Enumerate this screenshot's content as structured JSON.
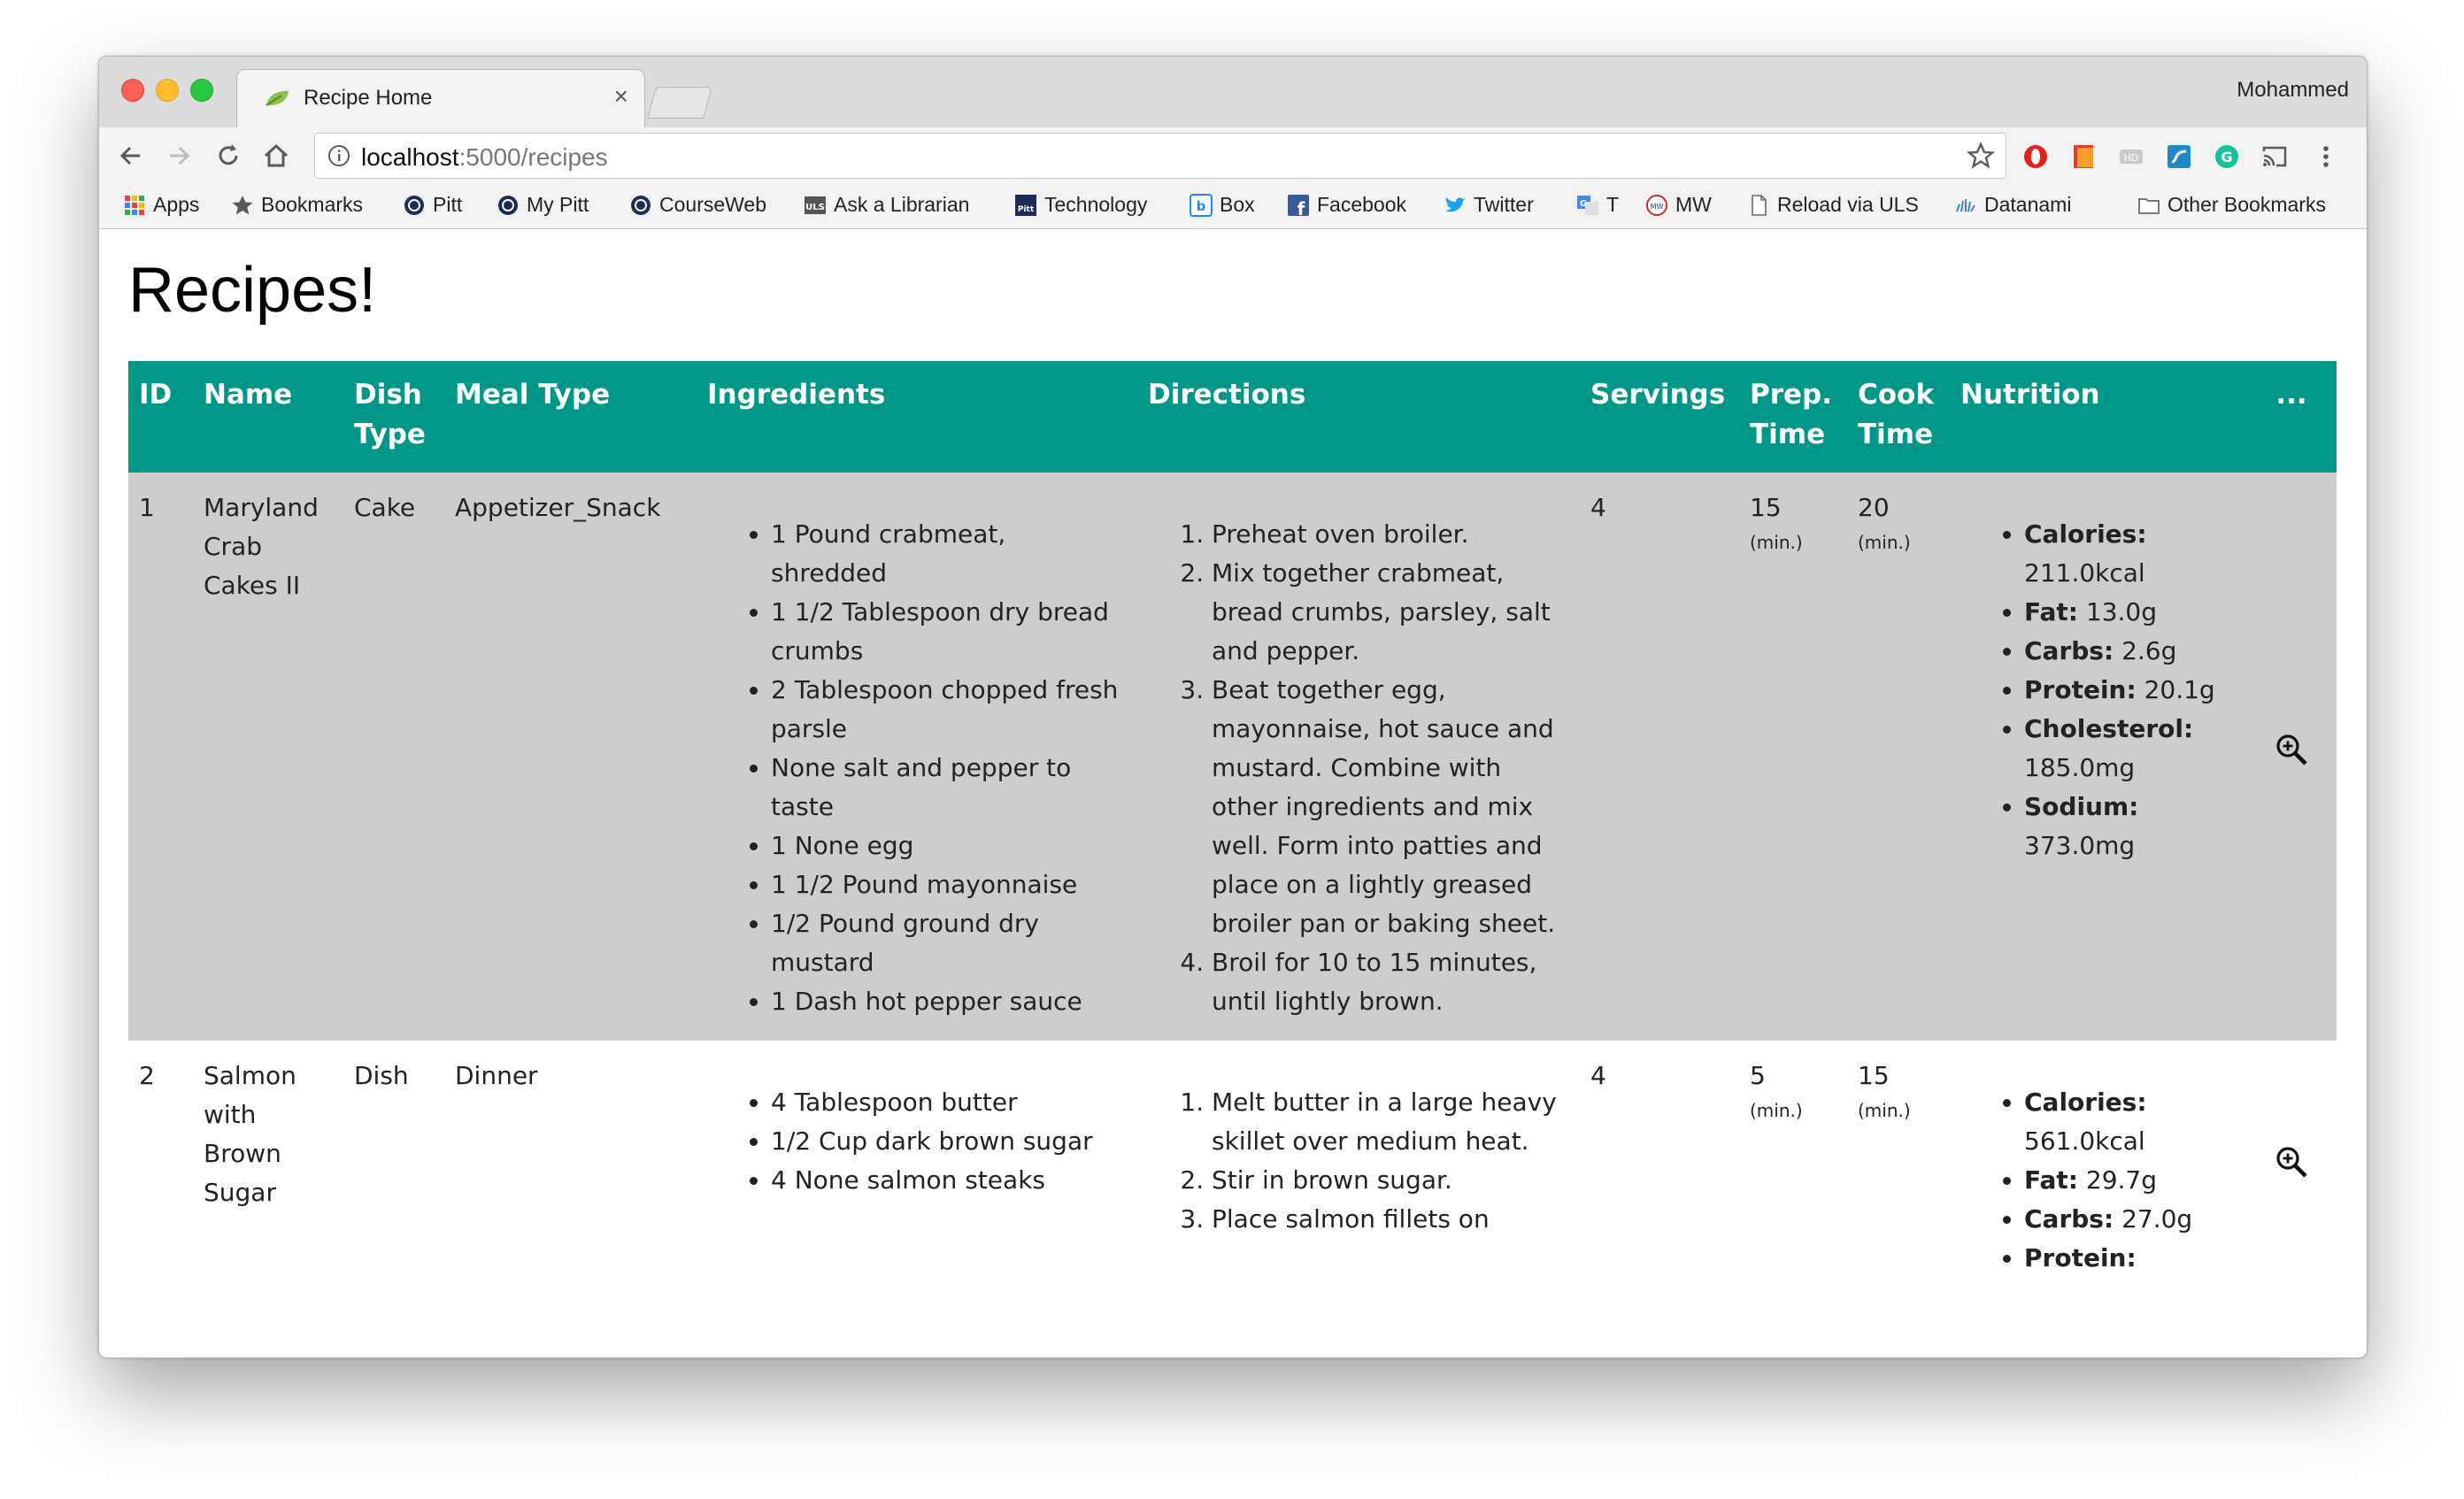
{
  "browser": {
    "tab_title": "Recipe Home",
    "tab_close": "×",
    "profile_name": "Mohammed",
    "url_host": "localhost",
    "url_path": ":5000/recipes"
  },
  "bookmarks": [
    {
      "label": "Apps",
      "icon": "apps-grid-icon"
    },
    {
      "label": "Bookmarks",
      "icon": "star-icon"
    },
    {
      "label": "Pitt",
      "icon": "pitt-seal-icon"
    },
    {
      "label": "My Pitt",
      "icon": "pitt-seal-icon"
    },
    {
      "label": "CourseWeb",
      "icon": "pitt-seal-icon"
    },
    {
      "label": "Ask a Librarian",
      "icon": "uls-icon"
    },
    {
      "label": "Technology",
      "icon": "pitt-tech-icon"
    },
    {
      "label": "Box",
      "icon": "box-icon"
    },
    {
      "label": "Facebook",
      "icon": "facebook-icon"
    },
    {
      "label": "Twitter",
      "icon": "twitter-icon"
    },
    {
      "label": "T",
      "icon": "translate-icon"
    },
    {
      "label": "MW",
      "icon": "merriam-webster-icon"
    },
    {
      "label": "Reload via ULS",
      "icon": "page-icon"
    },
    {
      "label": "Datanami",
      "icon": "datanami-icon"
    },
    {
      "label": "Other Bookmarks",
      "icon": "folder-icon"
    }
  ],
  "page": {
    "title": "Recipes!"
  },
  "table": {
    "headers": {
      "id": "ID",
      "name": "Name",
      "dish_type_1": "Dish",
      "dish_type_2": "Type",
      "meal_type": "Meal Type",
      "ingredients": "Ingredients",
      "directions": "Directions",
      "servings": "Servings",
      "prep_1": "Prep.",
      "prep_2": "Time",
      "cook_1": "Cook",
      "cook_2": "Time",
      "nutrition": "Nutrition",
      "more": "..."
    },
    "time_unit": "(min.)",
    "nutrition_labels": {
      "calories": "Calories:",
      "fat": "Fat:",
      "carbs": "Carbs:",
      "protein": "Protein:",
      "cholesterol": "Cholesterol:",
      "sodium": "Sodium:"
    },
    "rows": [
      {
        "id": "1",
        "name": "Maryland Crab Cakes II",
        "dish_type": "Cake",
        "meal_type": "Appetizer_Snack",
        "ingredients": [
          "1 Pound crabmeat, shredded",
          "1 1/2 Tablespoon dry bread crumbs",
          "2 Tablespoon chopped fresh parsle",
          "None salt and pepper to taste",
          "1 None egg",
          "1 1/2 Pound mayonnaise",
          "1/2 Pound ground dry mustard",
          "1 Dash hot pepper sauce"
        ],
        "directions": [
          "Preheat oven broiler.",
          "Mix together crabmeat, bread crumbs, parsley, salt and pepper.",
          "Beat together egg, mayonnaise, hot sauce and mustard. Combine with other ingredients and mix well. Form into patties and place on a lightly greased broiler pan or baking sheet.",
          "Broil for 10 to 15 minutes, until lightly brown."
        ],
        "servings": "4",
        "prep_time": "15",
        "cook_time": "20",
        "nutrition": {
          "calories": "211.0kcal",
          "fat": "13.0g",
          "carbs": "2.6g",
          "protein": "20.1g",
          "cholesterol": "185.0mg",
          "sodium": "373.0mg"
        }
      },
      {
        "id": "2",
        "name": "Salmon with Brown Sugar",
        "dish_type": "Dish",
        "meal_type": "Dinner",
        "ingredients": [
          "4 Tablespoon butter",
          "1/2 Cup dark brown sugar",
          "4 None salmon steaks"
        ],
        "directions": [
          "Melt butter in a large heavy skillet over medium heat.",
          "Stir in brown sugar.",
          "Place salmon fillets on"
        ],
        "servings": "4",
        "prep_time": "5",
        "cook_time": "15",
        "nutrition": {
          "calories": "561.0kcal",
          "fat": "29.7g",
          "carbs": "27.0g",
          "protein": ""
        }
      }
    ]
  }
}
